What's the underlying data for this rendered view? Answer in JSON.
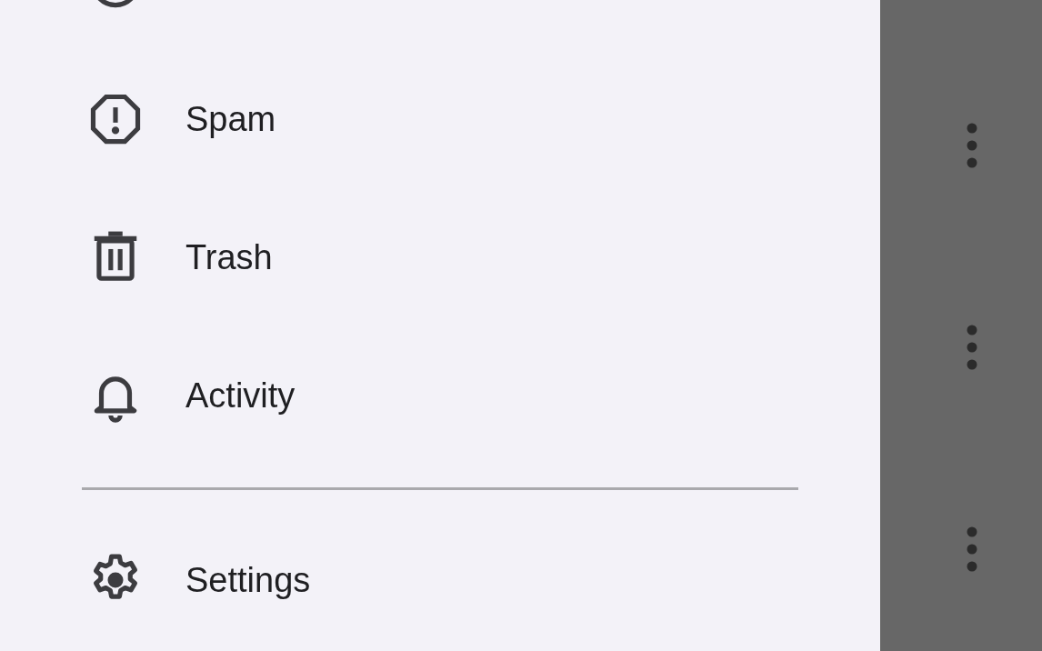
{
  "drawer": {
    "items": [
      {
        "label": "Spam"
      },
      {
        "label": "Trash"
      },
      {
        "label": "Activity"
      }
    ],
    "footer_items": [
      {
        "label": "Settings"
      }
    ]
  }
}
